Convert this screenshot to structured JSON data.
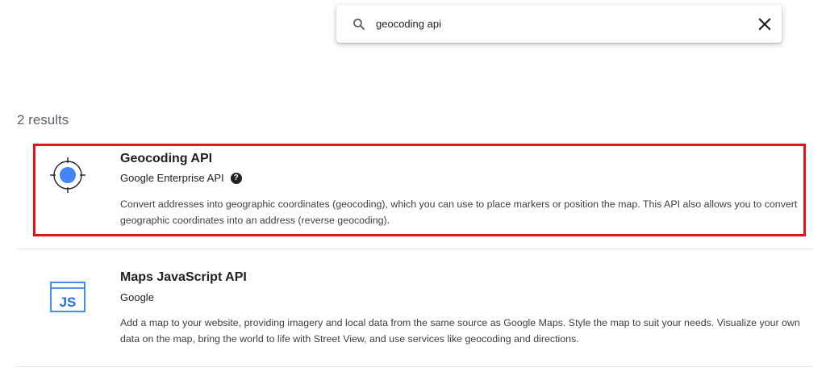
{
  "search": {
    "value": "geocoding api",
    "placeholder": ""
  },
  "results_count": "2 results",
  "results": [
    {
      "title": "Geocoding API",
      "provider": "Google Enterprise API",
      "help_icon": "?",
      "icon": "crosshair-target-icon",
      "description": "Convert addresses into geographic coordinates (geocoding), which you can use to place markers or position the map. This API also allows you to convert geographic coordinates into an address (reverse geocoding).",
      "highlighted": true
    },
    {
      "title": "Maps JavaScript API",
      "provider": "Google",
      "icon": "js-window-icon",
      "icon_text": "JS",
      "description": "Add a map to your website, providing imagery and local data from the same source as Google Maps. Style the map to suit your needs. Visualize your own data on the map, bring the world to life with Street View, and use services like geocoding and directions.",
      "highlighted": false
    }
  ],
  "colors": {
    "accent_blue": "#4285f4",
    "highlight_red": "#e8121b",
    "text": "#202124",
    "muted": "#5f6368"
  }
}
